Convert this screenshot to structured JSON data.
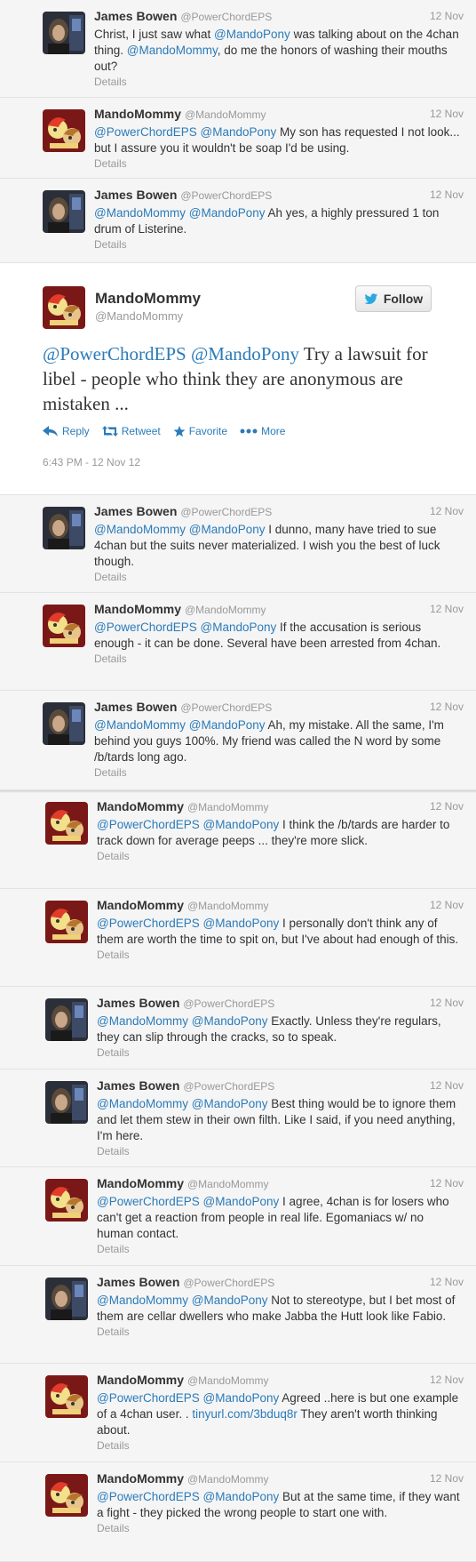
{
  "tweets_before": [
    {
      "name": "James Bowen",
      "handle": "@PowerChordEPS",
      "date": "12 Nov",
      "avatar": "james",
      "parts": [
        {
          "t": "Christ, I just saw what "
        },
        {
          "m": "@MandoPony"
        },
        {
          "t": " was talking about on the 4chan thing. "
        },
        {
          "m": "@MandoMommy"
        },
        {
          "t": ", do me the honors of washing their mouths out?"
        }
      ],
      "details": "Details"
    },
    {
      "name": "MandoMommy",
      "handle": "@MandoMommy",
      "date": "12 Nov",
      "avatar": "mando",
      "parts": [
        {
          "m": "@PowerChordEPS"
        },
        {
          "t": " "
        },
        {
          "m": "@MandoPony"
        },
        {
          "t": " My son has requested I not look... but I assure you it wouldn't be soap I'd be using."
        }
      ],
      "details": "Details"
    },
    {
      "name": "James Bowen",
      "handle": "@PowerChordEPS",
      "date": "12 Nov",
      "avatar": "james",
      "parts": [
        {
          "m": "@MandoMommy"
        },
        {
          "t": " "
        },
        {
          "m": "@MandoPony"
        },
        {
          "t": " Ah yes, a highly pressured 1 ton drum of Listerine."
        }
      ],
      "details": "Details"
    }
  ],
  "expanded": {
    "name": "MandoMommy",
    "handle": "@MandoMommy",
    "follow_label": "Follow",
    "parts": [
      {
        "m": "@PowerChordEPS"
      },
      {
        "t": " "
      },
      {
        "m": "@MandoPony"
      },
      {
        "t": " Try a lawsuit for libel - people who think they are anonymous are mistaken ..."
      }
    ],
    "actions": {
      "reply": "Reply",
      "retweet": "Retweet",
      "favorite": "Favorite",
      "more": "More"
    },
    "timestamp": "6:43 PM - 12 Nov 12"
  },
  "tweets_after": [
    {
      "name": "James Bowen",
      "handle": "@PowerChordEPS",
      "date": "12 Nov",
      "avatar": "james",
      "parts": [
        {
          "m": "@MandoMommy"
        },
        {
          "t": " "
        },
        {
          "m": "@MandoPony"
        },
        {
          "t": " I dunno, many have tried to sue 4chan but the suits never materialized. I wish you the best of luck though."
        }
      ],
      "details": "Details"
    },
    {
      "name": "MandoMommy",
      "handle": "@MandoMommy",
      "date": "12 Nov",
      "avatar": "mando",
      "parts": [
        {
          "m": "@PowerChordEPS"
        },
        {
          "t": " "
        },
        {
          "m": "@MandoPony"
        },
        {
          "t": " If the accusation is serious enough - it can be done.  Several have been arrested from 4chan."
        }
      ],
      "details": "Details"
    },
    {
      "name": "James Bowen",
      "handle": "@PowerChordEPS",
      "date": "12 Nov",
      "avatar": "james",
      "parts": [
        {
          "m": "@MandoMommy"
        },
        {
          "t": " "
        },
        {
          "m": "@MandoPony"
        },
        {
          "t": " Ah, my mistake. All the same, I'm behind you guys 100%. My friend was called the N word by some /b/tards long ago."
        }
      ],
      "details": "Details"
    }
  ],
  "tweets_lower": [
    {
      "name": "MandoMommy",
      "handle": "@MandoMommy",
      "date": "12 Nov",
      "avatar": "mando",
      "parts": [
        {
          "m": "@PowerChordEPS"
        },
        {
          "t": " "
        },
        {
          "m": "@MandoPony"
        },
        {
          "t": " I think the /b/tards are harder to track down for average peeps ... they're more slick."
        }
      ],
      "details": "Details"
    },
    {
      "name": "MandoMommy",
      "handle": "@MandoMommy",
      "date": "12 Nov",
      "avatar": "mando",
      "parts": [
        {
          "m": "@PowerChordEPS"
        },
        {
          "t": " "
        },
        {
          "m": "@MandoPony"
        },
        {
          "t": " I personally don't think any of them are worth the time to spit on, but I've about had enough of this."
        }
      ],
      "details": "Details"
    },
    {
      "name": "James Bowen",
      "handle": "@PowerChordEPS",
      "date": "12 Nov",
      "avatar": "james",
      "parts": [
        {
          "m": "@MandoMommy"
        },
        {
          "t": " "
        },
        {
          "m": "@MandoPony"
        },
        {
          "t": " Exactly. Unless they're regulars, they can slip through the cracks, so to speak."
        }
      ],
      "details": "Details"
    },
    {
      "name": "James Bowen",
      "handle": "@PowerChordEPS",
      "date": "12 Nov",
      "avatar": "james",
      "parts": [
        {
          "m": "@MandoMommy"
        },
        {
          "t": " "
        },
        {
          "m": "@MandoPony"
        },
        {
          "t": " Best thing would be to ignore them and let them stew in their own filth. Like I said, if you need anything, I'm here."
        }
      ],
      "details": "Details"
    },
    {
      "name": "MandoMommy",
      "handle": "@MandoMommy",
      "date": "12 Nov",
      "avatar": "mando",
      "parts": [
        {
          "m": "@PowerChordEPS"
        },
        {
          "t": " "
        },
        {
          "m": "@MandoPony"
        },
        {
          "t": " I agree, 4chan is for losers who can't get a reaction from people in real life. Egomaniacs w/ no human contact."
        }
      ],
      "details": "Details"
    },
    {
      "name": "James Bowen",
      "handle": "@PowerChordEPS",
      "date": "12 Nov",
      "avatar": "james",
      "parts": [
        {
          "m": "@MandoMommy"
        },
        {
          "t": " "
        },
        {
          "m": "@MandoPony"
        },
        {
          "t": " Not to stereotype, but I bet most of them are cellar dwellers who make Jabba the Hutt look like Fabio."
        }
      ],
      "details": "Details"
    },
    {
      "name": "MandoMommy",
      "handle": "@MandoMommy",
      "date": "12 Nov",
      "avatar": "mando",
      "parts": [
        {
          "m": "@PowerChordEPS"
        },
        {
          "t": " "
        },
        {
          "m": "@MandoPony"
        },
        {
          "t": " Agreed ..here is but one example of a 4chan user.  .  "
        },
        {
          "l": "tinyurl.com/3bduq8r"
        },
        {
          "t": "  They aren't worth thinking about."
        }
      ],
      "details": "Details"
    },
    {
      "name": "MandoMommy",
      "handle": "@MandoMommy",
      "date": "12 Nov",
      "avatar": "mando",
      "parts": [
        {
          "m": "@PowerChordEPS"
        },
        {
          "t": " "
        },
        {
          "m": "@MandoPony"
        },
        {
          "t": " But at the same time, if they want a fight - they picked the wrong people to start one with."
        }
      ],
      "details": "Details"
    }
  ]
}
